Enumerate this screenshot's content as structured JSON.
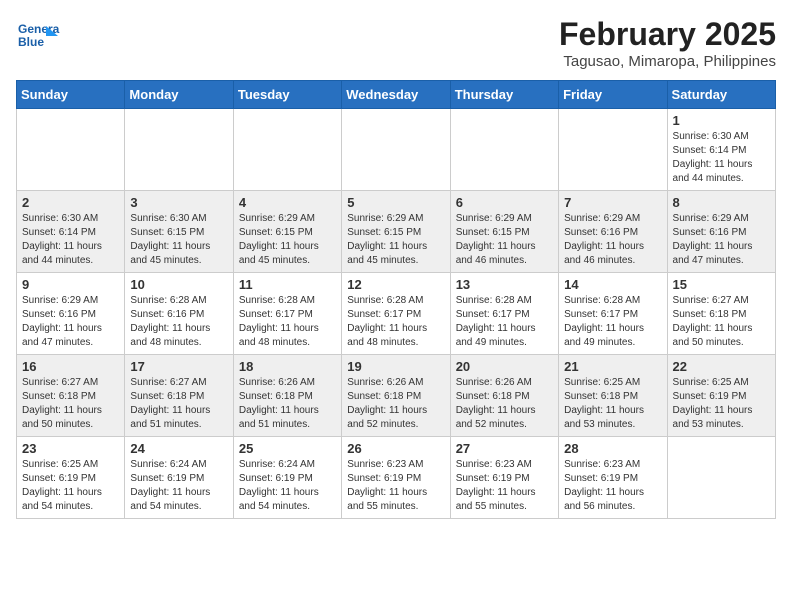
{
  "header": {
    "logo_line1": "General",
    "logo_line2": "Blue",
    "month": "February 2025",
    "location": "Tagusao, Mimaropa, Philippines"
  },
  "days_of_week": [
    "Sunday",
    "Monday",
    "Tuesday",
    "Wednesday",
    "Thursday",
    "Friday",
    "Saturday"
  ],
  "weeks": [
    [
      {
        "day": "",
        "info": ""
      },
      {
        "day": "",
        "info": ""
      },
      {
        "day": "",
        "info": ""
      },
      {
        "day": "",
        "info": ""
      },
      {
        "day": "",
        "info": ""
      },
      {
        "day": "",
        "info": ""
      },
      {
        "day": "1",
        "info": "Sunrise: 6:30 AM\nSunset: 6:14 PM\nDaylight: 11 hours\nand 44 minutes."
      }
    ],
    [
      {
        "day": "2",
        "info": "Sunrise: 6:30 AM\nSunset: 6:14 PM\nDaylight: 11 hours\nand 44 minutes."
      },
      {
        "day": "3",
        "info": "Sunrise: 6:30 AM\nSunset: 6:15 PM\nDaylight: 11 hours\nand 45 minutes."
      },
      {
        "day": "4",
        "info": "Sunrise: 6:29 AM\nSunset: 6:15 PM\nDaylight: 11 hours\nand 45 minutes."
      },
      {
        "day": "5",
        "info": "Sunrise: 6:29 AM\nSunset: 6:15 PM\nDaylight: 11 hours\nand 45 minutes."
      },
      {
        "day": "6",
        "info": "Sunrise: 6:29 AM\nSunset: 6:15 PM\nDaylight: 11 hours\nand 46 minutes."
      },
      {
        "day": "7",
        "info": "Sunrise: 6:29 AM\nSunset: 6:16 PM\nDaylight: 11 hours\nand 46 minutes."
      },
      {
        "day": "8",
        "info": "Sunrise: 6:29 AM\nSunset: 6:16 PM\nDaylight: 11 hours\nand 47 minutes."
      }
    ],
    [
      {
        "day": "9",
        "info": "Sunrise: 6:29 AM\nSunset: 6:16 PM\nDaylight: 11 hours\nand 47 minutes."
      },
      {
        "day": "10",
        "info": "Sunrise: 6:28 AM\nSunset: 6:16 PM\nDaylight: 11 hours\nand 48 minutes."
      },
      {
        "day": "11",
        "info": "Sunrise: 6:28 AM\nSunset: 6:17 PM\nDaylight: 11 hours\nand 48 minutes."
      },
      {
        "day": "12",
        "info": "Sunrise: 6:28 AM\nSunset: 6:17 PM\nDaylight: 11 hours\nand 48 minutes."
      },
      {
        "day": "13",
        "info": "Sunrise: 6:28 AM\nSunset: 6:17 PM\nDaylight: 11 hours\nand 49 minutes."
      },
      {
        "day": "14",
        "info": "Sunrise: 6:28 AM\nSunset: 6:17 PM\nDaylight: 11 hours\nand 49 minutes."
      },
      {
        "day": "15",
        "info": "Sunrise: 6:27 AM\nSunset: 6:18 PM\nDaylight: 11 hours\nand 50 minutes."
      }
    ],
    [
      {
        "day": "16",
        "info": "Sunrise: 6:27 AM\nSunset: 6:18 PM\nDaylight: 11 hours\nand 50 minutes."
      },
      {
        "day": "17",
        "info": "Sunrise: 6:27 AM\nSunset: 6:18 PM\nDaylight: 11 hours\nand 51 minutes."
      },
      {
        "day": "18",
        "info": "Sunrise: 6:26 AM\nSunset: 6:18 PM\nDaylight: 11 hours\nand 51 minutes."
      },
      {
        "day": "19",
        "info": "Sunrise: 6:26 AM\nSunset: 6:18 PM\nDaylight: 11 hours\nand 52 minutes."
      },
      {
        "day": "20",
        "info": "Sunrise: 6:26 AM\nSunset: 6:18 PM\nDaylight: 11 hours\nand 52 minutes."
      },
      {
        "day": "21",
        "info": "Sunrise: 6:25 AM\nSunset: 6:18 PM\nDaylight: 11 hours\nand 53 minutes."
      },
      {
        "day": "22",
        "info": "Sunrise: 6:25 AM\nSunset: 6:19 PM\nDaylight: 11 hours\nand 53 minutes."
      }
    ],
    [
      {
        "day": "23",
        "info": "Sunrise: 6:25 AM\nSunset: 6:19 PM\nDaylight: 11 hours\nand 54 minutes."
      },
      {
        "day": "24",
        "info": "Sunrise: 6:24 AM\nSunset: 6:19 PM\nDaylight: 11 hours\nand 54 minutes."
      },
      {
        "day": "25",
        "info": "Sunrise: 6:24 AM\nSunset: 6:19 PM\nDaylight: 11 hours\nand 54 minutes."
      },
      {
        "day": "26",
        "info": "Sunrise: 6:23 AM\nSunset: 6:19 PM\nDaylight: 11 hours\nand 55 minutes."
      },
      {
        "day": "27",
        "info": "Sunrise: 6:23 AM\nSunset: 6:19 PM\nDaylight: 11 hours\nand 55 minutes."
      },
      {
        "day": "28",
        "info": "Sunrise: 6:23 AM\nSunset: 6:19 PM\nDaylight: 11 hours\nand 56 minutes."
      },
      {
        "day": "",
        "info": ""
      }
    ]
  ]
}
